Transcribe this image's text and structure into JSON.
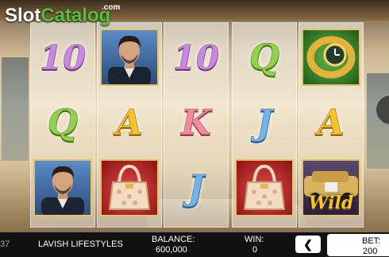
{
  "logo": {
    "slot": "Slot",
    "catalog": "Catalog",
    "com": ".com"
  },
  "reels": [
    [
      {
        "type": "card",
        "value": "10",
        "color": "#c889e6"
      },
      {
        "type": "card",
        "value": "Q",
        "color": "#8ed24e"
      },
      {
        "type": "tile",
        "symbol": "man"
      }
    ],
    [
      {
        "type": "tile",
        "symbol": "man"
      },
      {
        "type": "card",
        "value": "A",
        "color": "#f5c32c"
      },
      {
        "type": "tile",
        "symbol": "bag"
      }
    ],
    [
      {
        "type": "card",
        "value": "10",
        "color": "#c889e6"
      },
      {
        "type": "card",
        "value": "K",
        "color": "#f08aa0"
      },
      {
        "type": "card",
        "value": "J",
        "color": "#6cb5ee"
      }
    ],
    [
      {
        "type": "card",
        "value": "Q",
        "color": "#8ed24e"
      },
      {
        "type": "card",
        "value": "J",
        "color": "#6cb5ee"
      },
      {
        "type": "tile",
        "symbol": "bag"
      }
    ],
    [
      {
        "type": "tile",
        "symbol": "ring"
      },
      {
        "type": "card",
        "value": "A",
        "color": "#f5c32c"
      },
      {
        "type": "tile",
        "symbol": "wild",
        "label": "Wild"
      }
    ]
  ],
  "bar": {
    "left_cut": "37",
    "game_name": "LAVISH LIFESTYLES",
    "balance_label": "BALANCE:",
    "balance_value": "600,000",
    "win_label": "WIN:",
    "win_value": "0",
    "prev_label": "❮",
    "bet_label": "BET:",
    "bet_value": "200"
  }
}
